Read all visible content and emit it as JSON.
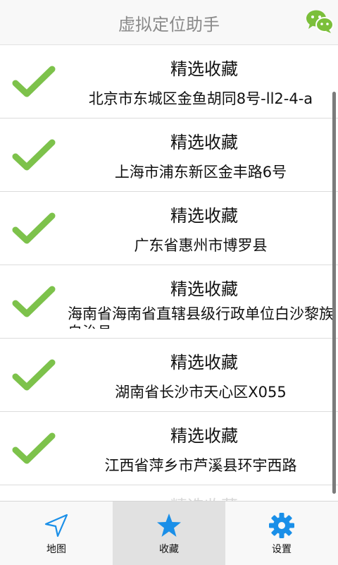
{
  "header": {
    "title": "虚拟定位助手",
    "wechat_icon": "wechat-icon"
  },
  "list": {
    "items": [
      {
        "title": "精选收藏",
        "address": "北京市东城区金鱼胡同8号-ll2-4-a"
      },
      {
        "title": "精选收藏",
        "address": "上海市浦东新区金丰路6号"
      },
      {
        "title": "精选收藏",
        "address": "广东省惠州市博罗县"
      },
      {
        "title": "精选收藏",
        "address": "海南省海南省直辖县级行政单位白沙黎族自治县"
      },
      {
        "title": "精选收藏",
        "address": "湖南省长沙市天心区X055"
      },
      {
        "title": "精选收藏",
        "address": "江西省萍乡市芦溪县环宇西路"
      },
      {
        "title": "精选收藏",
        "address": ""
      }
    ]
  },
  "tabs": [
    {
      "label": "地图",
      "icon": "navigation-arrow-icon"
    },
    {
      "label": "收藏",
      "icon": "star-icon",
      "active": true
    },
    {
      "label": "设置",
      "icon": "gear-icon"
    }
  ],
  "colors": {
    "check": "#7dc24b",
    "tab_icon": "#1a8fe8",
    "wechat": "#7bbf3a"
  }
}
